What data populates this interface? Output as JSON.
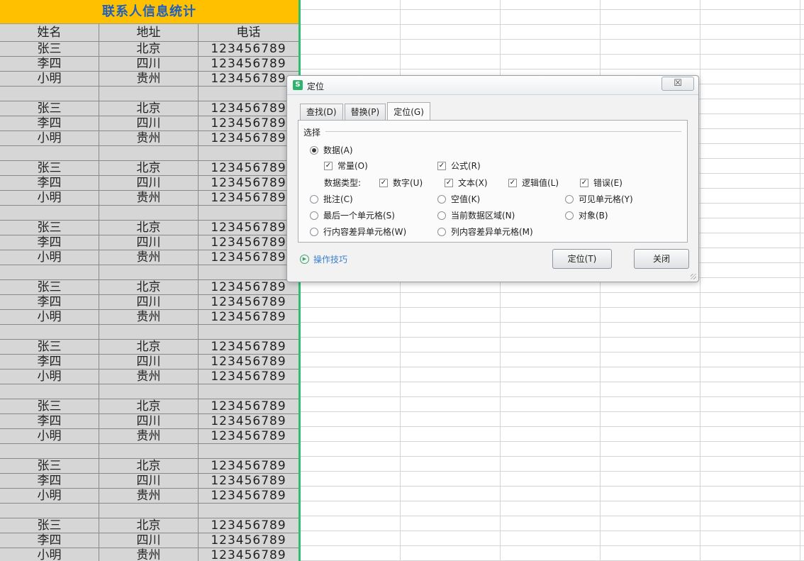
{
  "sheet": {
    "title": "联系人信息统计",
    "headers": [
      "姓名",
      "地址",
      "电话"
    ],
    "rows": [
      [
        "张三",
        "北京",
        "123456789"
      ],
      [
        "李四",
        "四川",
        "123456789"
      ],
      [
        "小明",
        "贵州",
        "123456789"
      ],
      [
        "",
        "",
        ""
      ],
      [
        "张三",
        "北京",
        "123456789"
      ],
      [
        "李四",
        "四川",
        "123456789"
      ],
      [
        "小明",
        "贵州",
        "123456789"
      ],
      [
        "",
        "",
        ""
      ],
      [
        "张三",
        "北京",
        "123456789"
      ],
      [
        "李四",
        "四川",
        "123456789"
      ],
      [
        "小明",
        "贵州",
        "123456789"
      ],
      [
        "",
        "",
        ""
      ],
      [
        "张三",
        "北京",
        "123456789"
      ],
      [
        "李四",
        "四川",
        "123456789"
      ],
      [
        "小明",
        "贵州",
        "123456789"
      ],
      [
        "",
        "",
        ""
      ],
      [
        "张三",
        "北京",
        "123456789"
      ],
      [
        "李四",
        "四川",
        "123456789"
      ],
      [
        "小明",
        "贵州",
        "123456789"
      ],
      [
        "",
        "",
        ""
      ],
      [
        "张三",
        "北京",
        "123456789"
      ],
      [
        "李四",
        "四川",
        "123456789"
      ],
      [
        "小明",
        "贵州",
        "123456789"
      ],
      [
        "",
        "",
        ""
      ],
      [
        "张三",
        "北京",
        "123456789"
      ],
      [
        "李四",
        "四川",
        "123456789"
      ],
      [
        "小明",
        "贵州",
        "123456789"
      ],
      [
        "",
        "",
        ""
      ],
      [
        "张三",
        "北京",
        "123456789"
      ],
      [
        "李四",
        "四川",
        "123456789"
      ],
      [
        "小明",
        "贵州",
        "123456789"
      ],
      [
        "",
        "",
        ""
      ],
      [
        "张三",
        "北京",
        "123456789"
      ],
      [
        "李四",
        "四川",
        "123456789"
      ],
      [
        "小明",
        "贵州",
        "123456789"
      ]
    ]
  },
  "dialog": {
    "app_icon": "S",
    "title": "定位",
    "close_symbol": "☒",
    "tabs": [
      {
        "label": "查找(D)",
        "active": false
      },
      {
        "label": "替换(P)",
        "active": false
      },
      {
        "label": "定位(G)",
        "active": true
      }
    ],
    "group_label": "选择",
    "options": {
      "data": {
        "label": "数据(A)",
        "checked": true
      },
      "constant": {
        "label": "常量(O)",
        "checked": true
      },
      "formula": {
        "label": "公式(R)",
        "checked": true
      },
      "data_type_label": "数据类型:",
      "number": {
        "label": "数字(U)",
        "checked": true
      },
      "text": {
        "label": "文本(X)",
        "checked": true
      },
      "logical": {
        "label": "逻辑值(L)",
        "checked": true
      },
      "error": {
        "label": "错误(E)",
        "checked": true
      },
      "comment": {
        "label": "批注(C)",
        "checked": false
      },
      "blank": {
        "label": "空值(K)",
        "checked": false
      },
      "visible_cells": {
        "label": "可见单元格(Y)",
        "checked": false
      },
      "last_cell": {
        "label": "最后一个单元格(S)",
        "checked": false
      },
      "current_region": {
        "label": "当前数据区域(N)",
        "checked": false
      },
      "objects": {
        "label": "对象(B)",
        "checked": false
      },
      "row_diff": {
        "label": "行内容差异单元格(W)",
        "checked": false
      },
      "col_diff": {
        "label": "列内容差异单元格(M)",
        "checked": false
      }
    },
    "tips_label": "操作技巧",
    "locate_button": "定位(T)",
    "close_button": "关闭"
  },
  "colors": {
    "title_bg": "#ffc000",
    "title_text": "#1f5fbf",
    "selection_border": "#2fbf71"
  }
}
